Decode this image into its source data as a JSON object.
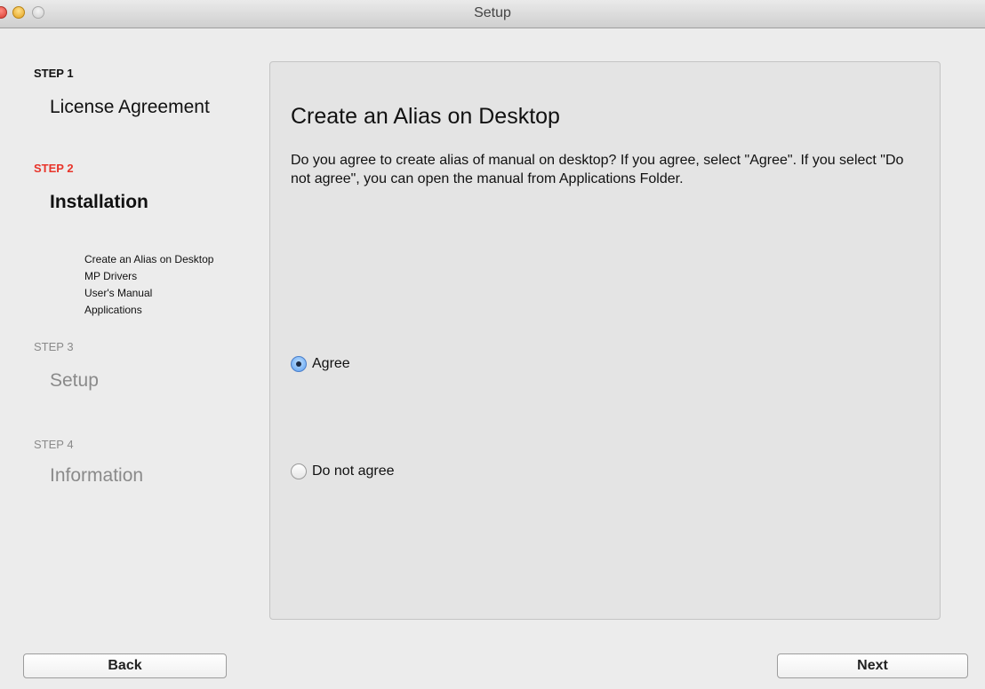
{
  "window": {
    "title": "Setup"
  },
  "sidebar": {
    "steps": [
      {
        "label": "STEP 1",
        "title": "License Agreement"
      },
      {
        "label": "STEP 2",
        "title": "Installation"
      },
      {
        "label": "STEP 3",
        "title": "Setup"
      },
      {
        "label": "STEP 4",
        "title": "Information"
      }
    ],
    "substeps": [
      "Create an Alias on Desktop",
      "MP Drivers",
      "User's Manual",
      "Applications"
    ]
  },
  "main": {
    "heading": "Create an Alias on Desktop",
    "description": "Do you agree to create alias of manual on desktop? If you agree, select \"Agree\". If you select \"Do not agree\", you can open the manual from Applications Folder.",
    "options": [
      {
        "label": "Agree",
        "selected": true
      },
      {
        "label": "Do not agree",
        "selected": false
      }
    ]
  },
  "buttons": {
    "back": "Back",
    "next": "Next"
  },
  "colors": {
    "active_step": "#e8342a",
    "panel_bg": "#e4e4e4",
    "window_bg": "#ececec"
  },
  "icons": {
    "close": "close-traffic-light",
    "minimize": "minimize-traffic-light",
    "zoom": "zoom-traffic-light",
    "radio_on": "radio-selected",
    "radio_off": "radio-unselected"
  }
}
